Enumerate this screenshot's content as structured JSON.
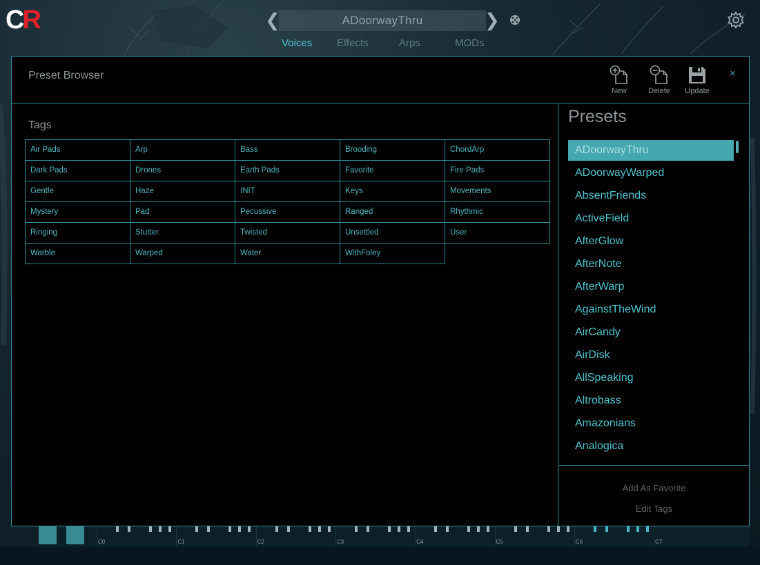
{
  "app": {
    "logo": {
      "c": "C",
      "r": "R"
    },
    "current_preset": "ADoorwayThru",
    "nav": {
      "prev": "❮",
      "next": "❯"
    },
    "tabs": [
      {
        "label": "Voices",
        "active": true
      },
      {
        "label": "Effects",
        "active": false
      },
      {
        "label": "Arps",
        "active": false
      },
      {
        "label": "MODs",
        "active": false
      }
    ]
  },
  "browser": {
    "title": "Preset Browser",
    "buttons": {
      "new": "New",
      "delete": "Delete",
      "update": "Update"
    },
    "close": "×",
    "tags_title": "Tags",
    "tags": [
      [
        "Air Pads",
        "Arp",
        "Bass",
        "Brooding",
        "ChordArp"
      ],
      [
        "Dark Pads",
        "Drones",
        "Earth Pads",
        "Favorite",
        "Fire Pads"
      ],
      [
        "Gentle",
        "Haze",
        "INIT",
        "Keys",
        "Movements"
      ],
      [
        "Mystery",
        "Pad",
        "Pecussive",
        "Ranged",
        "Rhythmic"
      ],
      [
        "Ringing",
        "Stutter",
        "Twisted",
        "Unsettled",
        "User"
      ],
      [
        "Warble",
        "Warped",
        "Water",
        "WithFoley"
      ]
    ],
    "presets_title": "Presets",
    "presets": [
      "ADoorwayThru",
      "ADoorwayWarped",
      "AbsentFriends",
      "ActiveField",
      "AfterGlow",
      "AfterNote",
      "AfterWarp",
      "AgainstTheWind",
      "AirCandy",
      "AirDisk",
      "AllSpeaking",
      "Altrobass",
      "Amazonians",
      "Analogica"
    ],
    "selected_preset": "ADoorwayThru",
    "footer": {
      "add_favorite": "Add As Favorite",
      "edit_tags": "Edit Tags"
    }
  },
  "keyboard": {
    "octave_labels": [
      "C0",
      "C1",
      "C2",
      "C3",
      "C4",
      "C5",
      "C6",
      "C7"
    ]
  },
  "colors": {
    "accent": "#4fc3cf",
    "border": "#2f8e98",
    "selected_bg": "#45a7b0",
    "logo_red": "#e0202a"
  }
}
